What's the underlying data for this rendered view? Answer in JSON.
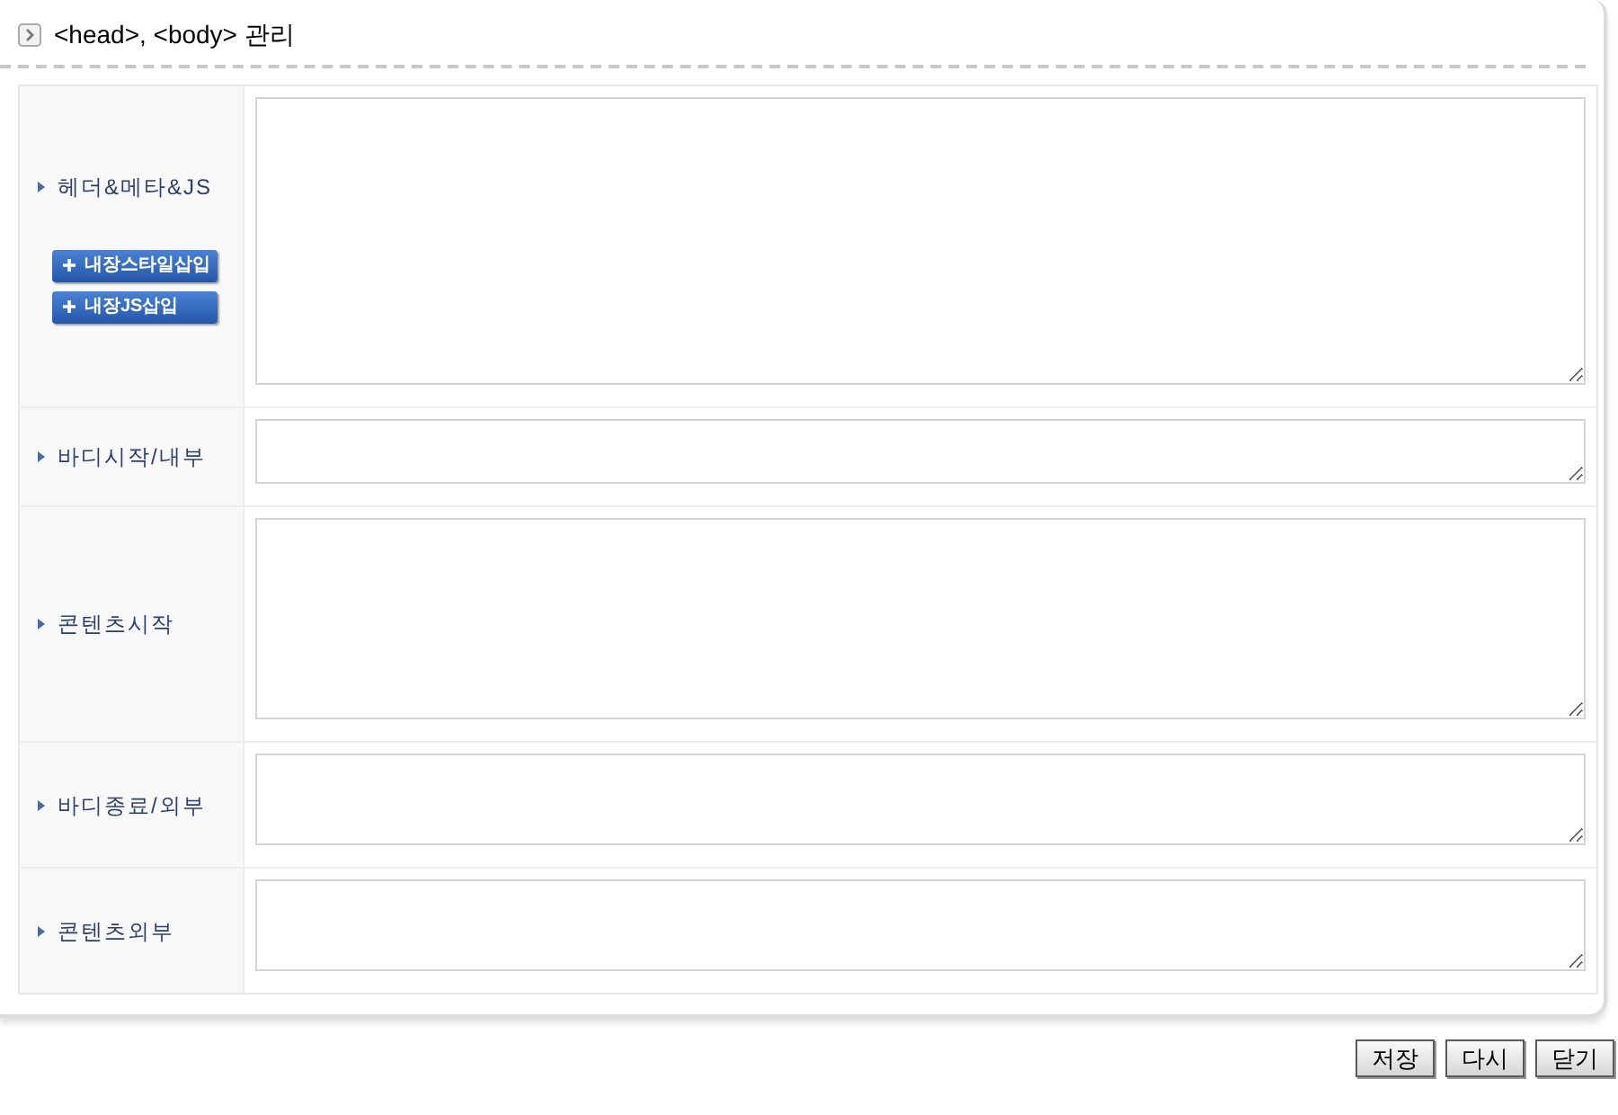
{
  "header": {
    "title": "<head>, <body> 관리"
  },
  "rows": [
    {
      "label": "헤더&메타&JS",
      "buttons": [
        "내장스타일삽입",
        "내장JS삽입"
      ]
    },
    {
      "label": "바디시작/내부"
    },
    {
      "label": "콘텐츠시작"
    },
    {
      "label": "바디종료/외부"
    },
    {
      "label": "콘텐츠외부"
    }
  ],
  "actions": [
    "저장",
    "다시",
    "닫기"
  ]
}
